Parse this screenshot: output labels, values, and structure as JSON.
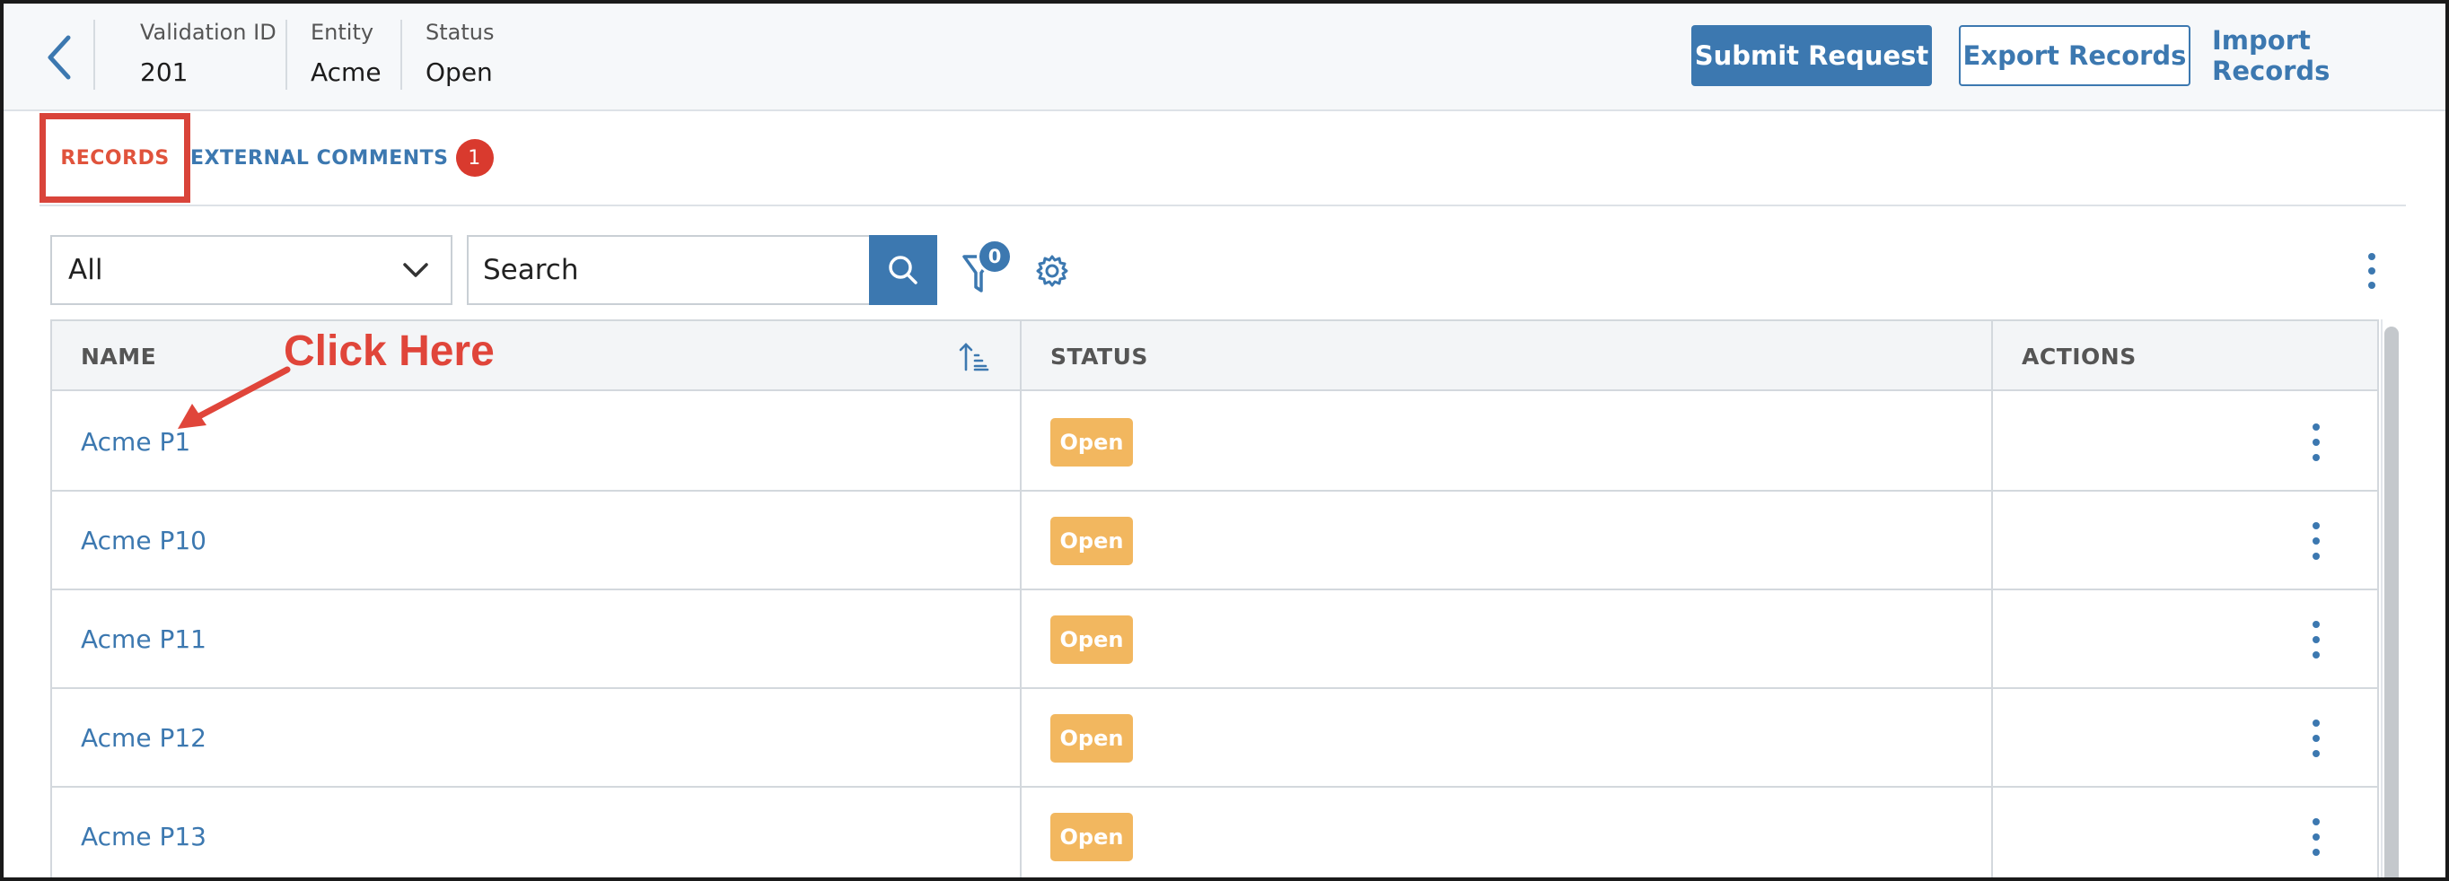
{
  "header": {
    "meta": [
      {
        "label": "Validation ID",
        "value": "201"
      },
      {
        "label": "Entity",
        "value": "Acme"
      },
      {
        "label": "Status",
        "value": "Open"
      }
    ],
    "submit_label": "Submit Request",
    "export_label": "Export Records",
    "import_label": "Import Records"
  },
  "tabs": {
    "records_label": "RECORDS",
    "comments_label": "EXTERNAL COMMENTS",
    "comments_count": "1"
  },
  "toolbar": {
    "select_value": "All",
    "search_placeholder": "Search",
    "filter_count": "0"
  },
  "table": {
    "columns": [
      "NAME",
      "STATUS",
      "ACTIONS"
    ],
    "rows": [
      {
        "name": "Acme P1",
        "status": "Open"
      },
      {
        "name": "Acme P10",
        "status": "Open"
      },
      {
        "name": "Acme P11",
        "status": "Open"
      },
      {
        "name": "Acme P12",
        "status": "Open"
      },
      {
        "name": "Acme P13",
        "status": "Open"
      }
    ]
  },
  "annotation": {
    "text": "Click Here",
    "color": "#e0453a"
  },
  "colors": {
    "accent": "#3c78b0",
    "status_open": "#f2b75f",
    "badge_red": "#d93a2e",
    "highlight_box": "#d9443a"
  },
  "icons": {
    "back": "chevron-left-icon",
    "search": "search-icon",
    "filter": "filter-icon",
    "settings": "gear-icon",
    "more": "kebab-menu-icon",
    "sort": "sort-ascending-icon",
    "dropdown": "chevron-down-icon"
  }
}
